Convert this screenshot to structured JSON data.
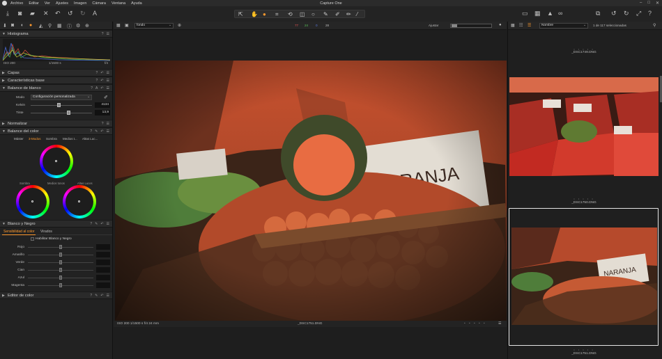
{
  "window": {
    "title": "Capture One",
    "menu": [
      "Archivo",
      "Editar",
      "Ver",
      "Ajustes",
      "Imagen",
      "Cámara",
      "Ventana",
      "Ayuda"
    ]
  },
  "left_panel": {
    "histogram": {
      "title": "Histograma",
      "iso": "ISO 200",
      "shutter": "1/1500 s",
      "aperture": "f/4"
    },
    "sections": {
      "capas": "Capas",
      "caracteristicas": "Características base",
      "balance_blanco": "Balance de blanco",
      "normalizar": "Normalizar",
      "balance_color": "Balance del color",
      "blanco_negro": "Blanco y Negro",
      "editor_color": "Editor de color"
    },
    "white_balance": {
      "mode_label": "Modo",
      "mode_value": "Configuración personalizada",
      "kelvin_label": "Kelvin",
      "kelvin_value": "4134",
      "tint_label": "Tinte",
      "tint_value": "13,9"
    },
    "color_balance": {
      "tabs": [
        "Máster",
        "3-Modos",
        "Sombra",
        "Medios t...",
        "Altas Luc..."
      ],
      "active_tab": 1,
      "wheel_labels": [
        "Sombra",
        "Medios tonos",
        "Altas Luces"
      ]
    },
    "black_white": {
      "tabs": [
        "Sensibilidad al color",
        "Virados"
      ],
      "enable_label": "Habilitar Blanco y Negro",
      "rows": [
        "Rojo",
        "Amarillo",
        "Verde",
        "Cian",
        "Azul",
        "Magenta"
      ]
    }
  },
  "viewer": {
    "preset_select": "fondo",
    "channels": [
      "77",
      "24",
      "0",
      "28"
    ],
    "adjust_label": "Ajustar",
    "footer_meta": "ISO 200  1/1500 s  f/4  24 mm",
    "filename": "_DSC1751.DNG",
    "photo_sign_text": "NARANJA"
  },
  "browser": {
    "sort_select": "Nombre",
    "count_text": "1 de 117 seleccionadas",
    "thumbnails": [
      {
        "name": "_DSC1749.DNG",
        "selected": false
      },
      {
        "name": "_DSC1750.DNG",
        "selected": false
      },
      {
        "name": "_DSC1751.DNG",
        "selected": true
      }
    ]
  },
  "colors": {
    "accent": "#ff9a2e",
    "panel": "#222222",
    "background": "#1e1e1e"
  }
}
